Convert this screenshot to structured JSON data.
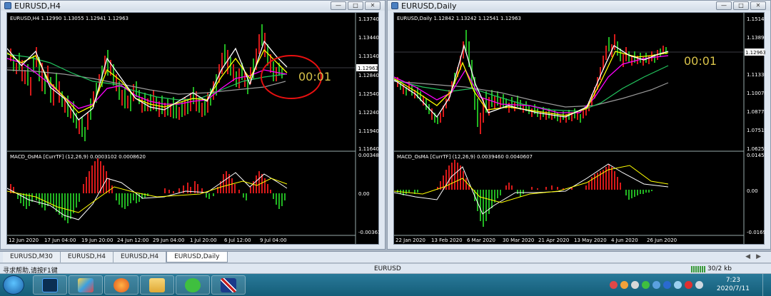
{
  "windows": {
    "left": {
      "title": "EURUSD,H4",
      "header": "EURUSD,H4  1.12990 1.13055 1.12941 1.12963",
      "price_label": "1.12963",
      "timer": "00:01",
      "price_axis": [
        "1.13740",
        "1.13440",
        "1.13140",
        "1.12840",
        "1.12540",
        "1.12240",
        "1.11940",
        "1.11640"
      ],
      "macd_label": "MACD_OsMA [CurrTF] (12,26,9) 0.0003102 0.0008620",
      "macd_axis": [
        "0.0034869",
        "0.00",
        "-0.0036134"
      ],
      "time_axis": [
        "12 Jun 2020",
        "17 Jun 04:00",
        "19 Jun 20:00",
        "24 Jun 12:00",
        "29 Jun 04:00",
        "1 Jul 20:00",
        "6 Jul 12:00",
        "9 Jul 04:00"
      ]
    },
    "right": {
      "title": "EURUSD,Daily",
      "header": "EURUSD,Daily  1.12842 1.13242 1.12541 1.12963",
      "price_label": "1.12963",
      "timer": "00:01",
      "price_axis": [
        "1.15145",
        "1.13890",
        "1.11330",
        "1.10070",
        "1.08775",
        "1.07515",
        "1.06255"
      ],
      "macd_label": "MACD_OsMA [CurrTF] (12,26,9) 0.0039460 0.0040607",
      "macd_axis": [
        "0.0145509",
        "0.00",
        "-0.0169957"
      ],
      "time_axis": [
        "22 Jan 2020",
        "13 Feb 2020",
        "6 Mar 2020",
        "30 Mar 2020",
        "21 Apr 2020",
        "13 May 2020",
        "4 Jun 2020",
        "26 Jun 2020"
      ]
    }
  },
  "window_buttons": {
    "minimize": "—",
    "maximize": "□",
    "close": "✕"
  },
  "tabs": [
    "EURUSD,M30",
    "EURUSD,H4",
    "EURUSD,H4",
    "EURUSD,Daily"
  ],
  "status": {
    "help": "寻求帮助,请按F1键",
    "symbol": "EURUSD",
    "net": "30/2 kb"
  },
  "clock": {
    "time": "7:23",
    "date": "2020/7/11"
  },
  "icons": {
    "start": "windows-start-icon",
    "taskbar": [
      "photoshop-icon",
      "mt4-chart-icon",
      "firefox-icon",
      "folder-icon",
      "wechat-icon",
      "uk-flag-icon"
    ]
  },
  "colors": {
    "accent_timer": "#d8c24a",
    "circle": "#e81010",
    "bull": "#22b522",
    "bear": "#d81a1a",
    "ma_white": "#ffffff",
    "ma_yellow": "#ffff00",
    "ma_magenta": "#ff00ff",
    "ma_green": "#22c55e",
    "ma_gray": "#9a9a9a"
  }
}
